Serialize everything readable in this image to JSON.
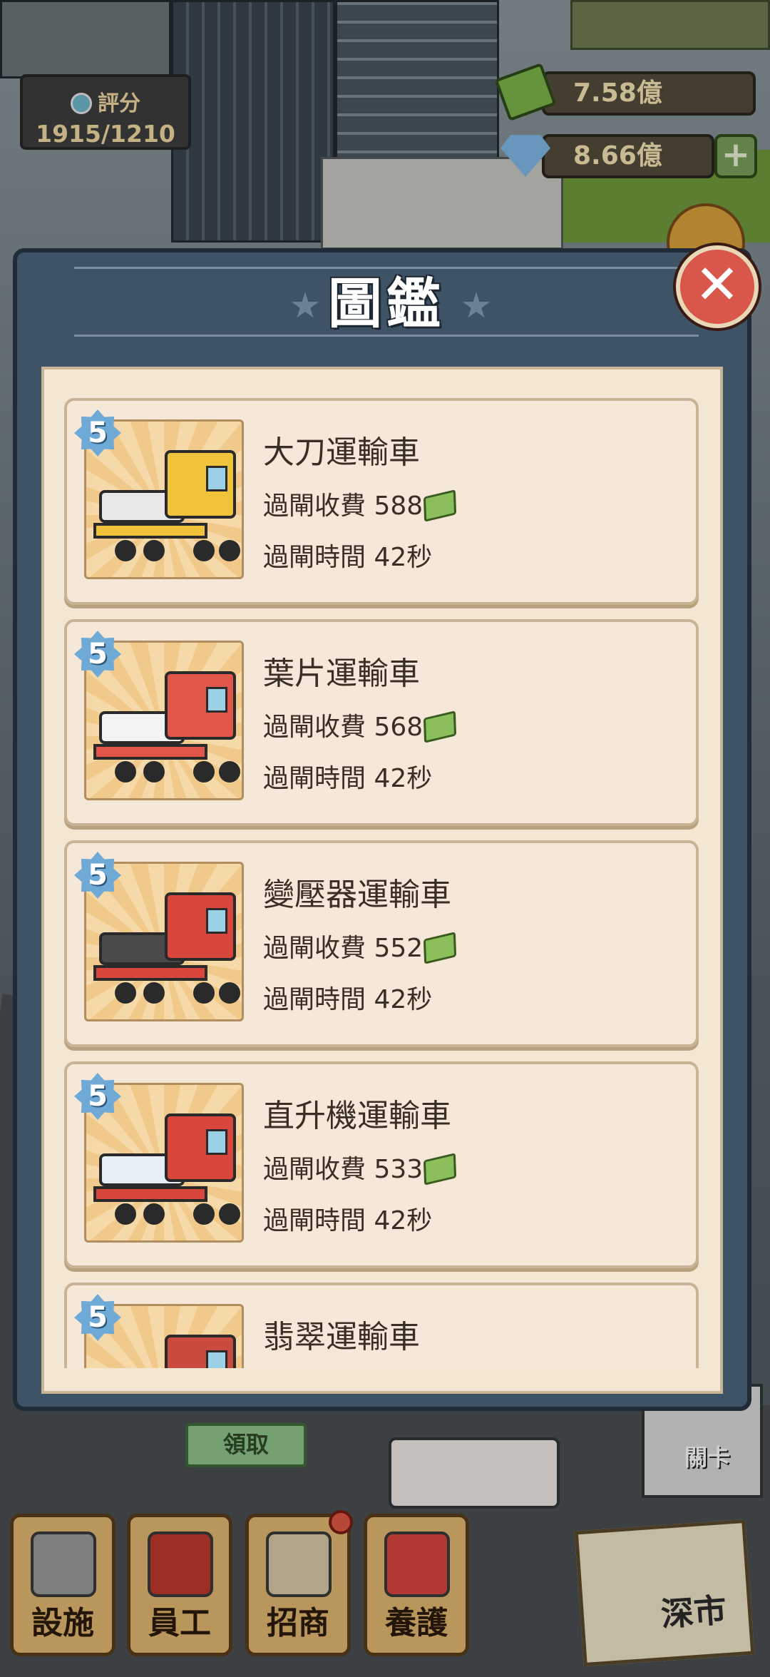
{
  "hud": {
    "score_label": "評分",
    "score_value": "1915/1210",
    "money": "7.58億",
    "gems": "8.66億",
    "add_label": "+"
  },
  "modal": {
    "title": "圖鑑",
    "close_label": "✕",
    "vehicles": [
      {
        "level": "5",
        "name": "大刀運輸車",
        "fee_label": "過閘收費",
        "fee": "588",
        "time_label": "過閘時間",
        "time": "42秒",
        "cab_color": "#f0c43a",
        "cargo_color": "#e8e8e8"
      },
      {
        "level": "5",
        "name": "葉片運輸車",
        "fee_label": "過閘收費",
        "fee": "568",
        "time_label": "過閘時間",
        "time": "42秒",
        "cab_color": "#e2564a",
        "cargo_color": "#f4f4f4"
      },
      {
        "level": "5",
        "name": "變壓器運輸車",
        "fee_label": "過閘收費",
        "fee": "552",
        "time_label": "過閘時間",
        "time": "42秒",
        "cab_color": "#d9463c",
        "cargo_color": "#4a4a4a"
      },
      {
        "level": "5",
        "name": "直升機運輸車",
        "fee_label": "過閘收費",
        "fee": "533",
        "time_label": "過閘時間",
        "time": "42秒",
        "cab_color": "#d9463c",
        "cargo_color": "#e8eef5"
      },
      {
        "level": "5",
        "name": "翡翠運輸車",
        "fee_label": "",
        "fee": "",
        "time_label": "",
        "time": "",
        "cab_color": "#c94a3e",
        "cargo_color": "#cfe3d3"
      }
    ]
  },
  "bottom": {
    "claim_label": "領取",
    "level_tag": "關卡",
    "level_name": "深市",
    "nav": [
      {
        "label": "設施",
        "icon": "camera-icon",
        "color": "#9a9a9a",
        "badge": false
      },
      {
        "label": "員工",
        "icon": "staff-icon",
        "color": "#c0392b",
        "badge": false
      },
      {
        "label": "招商",
        "icon": "billboard-icon",
        "color": "#d8c9a6",
        "badge": true
      },
      {
        "label": "養護",
        "icon": "maintenance-icon",
        "color": "#d9463c",
        "badge": false
      }
    ]
  }
}
